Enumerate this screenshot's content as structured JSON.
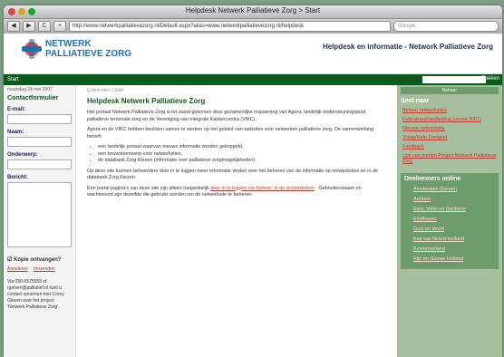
{
  "window": {
    "title": "Helpdesk Netwerk Palliatieve Zorg > Start"
  },
  "toolbar": {
    "back": "◀",
    "forward": "▶",
    "reload": "C",
    "add": "+",
    "url": "http://www.netwerkpalliatievezorg.nl/Default.aspx?alias=www.netwerkpalliatievezorg.nl/helpdesk",
    "search_placeholder": "Google"
  },
  "header": {
    "logo_line1": "NETWERK",
    "logo_line2": "PALLIATIEVE ZORG",
    "title": "Helpdesk en informatie - Network Palliatieve Zorg"
  },
  "nav": {
    "start": "Start",
    "search_button": "Zoeken"
  },
  "left": {
    "date": "maandag 24 mei 2007",
    "form_title": "Contactformulier",
    "fields": [
      "E-mail:",
      "Naam:",
      "Onderwerp:",
      "Bericht:"
    ],
    "checkbox": "Kopie ontvangen?",
    "buttons": [
      "Annuleren",
      "Verzenden"
    ],
    "note": "Via 030-6575558 of rgelsen@palliatief.nl kunt u contact opnemen met Corey Gleven over het project 'Netwerk Palliatieve Zorg'."
  },
  "main": {
    "crumb": "U bent hier: | Start",
    "heading": "Helpdesk Netwerk Palliatieve Zorg",
    "p1": "Het portaal Netwerk Palliatieve Zorg is tot stand gekomen door gezamenlijke inspanning van Agora, landelijk ondersteuningspunt palliatieve terminale zorg en de Vereniging van Integrale Kankercentra (VIKC).",
    "p2": "Agora en de VIKC hebben besloten samen te werken op het gebied van websites voor netwerken palliatieve zorg. De samenwerking betreft:",
    "bullets": [
      "een landelijk portaal waarvan nieuws informatie worden gekoppeld,",
      "een bouwsteenwerp voor netwerksites,",
      "de databank Zorg Kiezen (informatie over palliatieve zorgmogelijkheden)."
    ],
    "p3": "Op deze site kunnen beheerders door in te loggen meer informatie vinden over het beheren van de informatie op netwerksites en in de databank Zorg Kiezen.",
    "p4_pre": "Een portal pagina's van deze site zijn alleen toegankelijk ",
    "p4_link": "door in te loggen via 'beheer' in de rechterkolom",
    "p4_post": ". Gebruikersnaam en wachtwoord zijn dezelfde die gebruikt worden om de netwerksite te beheren."
  },
  "right": {
    "header": "Beheer",
    "section_title": "Snel naar",
    "links": [
      "Beheer netwerksites",
      "Gebruikershandleiding (versie 2007)",
      "Nieuwe netwerksite",
      "Vraag/Help Zoekpad",
      "Feedback",
      "Lijst van punten Project Netwerk Palliatieve Zorg"
    ],
    "members_title": "Deelnemers online",
    "members": [
      "Amsterdam-Diemen",
      "Arnhem",
      "Eem, Vallei en Gelderse",
      "Eindhoven",
      "Gooi en Vecht",
      "Kop van Noord-Holland",
      "Kennemerland",
      "Rijn en Gouwe Holland"
    ]
  },
  "colors": {
    "brand_green": "#0d5a1f",
    "sidebar_green": "#a5bf9e",
    "link_red": "#c0392b",
    "logo_blue": "#1f6fb5"
  }
}
